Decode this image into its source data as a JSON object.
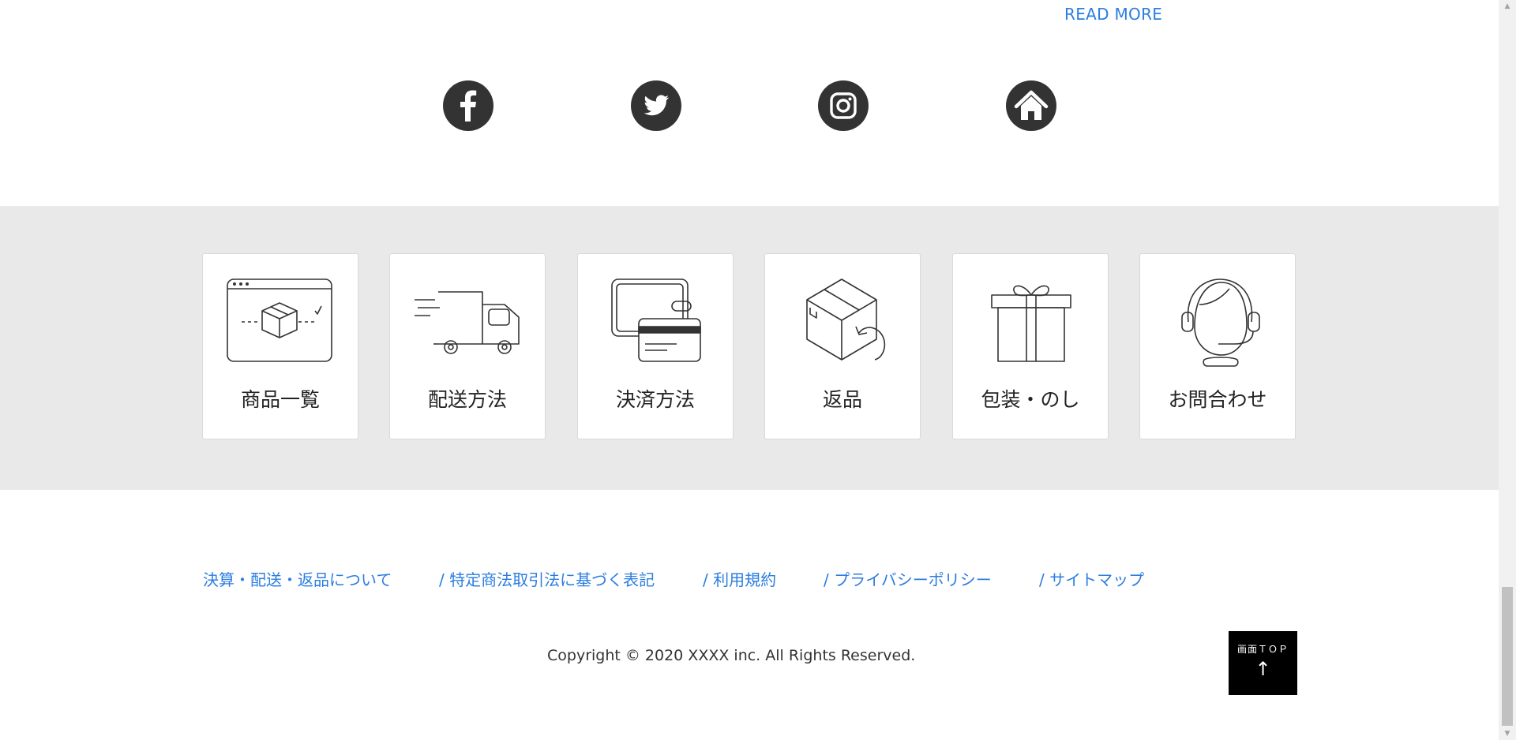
{
  "read_more": "READ MORE",
  "social": [
    {
      "name": "facebook",
      "icon": "facebook-icon"
    },
    {
      "name": "twitter",
      "icon": "twitter-icon"
    },
    {
      "name": "instagram",
      "icon": "instagram-icon"
    },
    {
      "name": "home",
      "icon": "home-icon"
    }
  ],
  "menu_cards": [
    {
      "label": "商品一覧",
      "icon": "product-box-icon"
    },
    {
      "label": "配送方法",
      "icon": "delivery-truck-icon"
    },
    {
      "label": "決済方法",
      "icon": "wallet-card-icon"
    },
    {
      "label": "返品",
      "icon": "return-box-icon"
    },
    {
      "label": "包装・のし",
      "icon": "gift-box-icon"
    },
    {
      "label": "お問合わせ",
      "icon": "support-headset-icon"
    }
  ],
  "footer_links": [
    "決算・配送・返品について",
    "/ 特定商法取引法に基づく表記",
    "/ 利用規約",
    "/ プライバシーポリシー",
    "/ サイトマップ"
  ],
  "copyright": "Copyright © 2020 XXXX inc. All Rights Reserved.",
  "top_button": {
    "label": "画面ＴＯＰ",
    "arrow": "↑"
  },
  "colors": {
    "link": "#2b7de0",
    "band": "#e9e9e9",
    "icon_dark": "#333333"
  }
}
